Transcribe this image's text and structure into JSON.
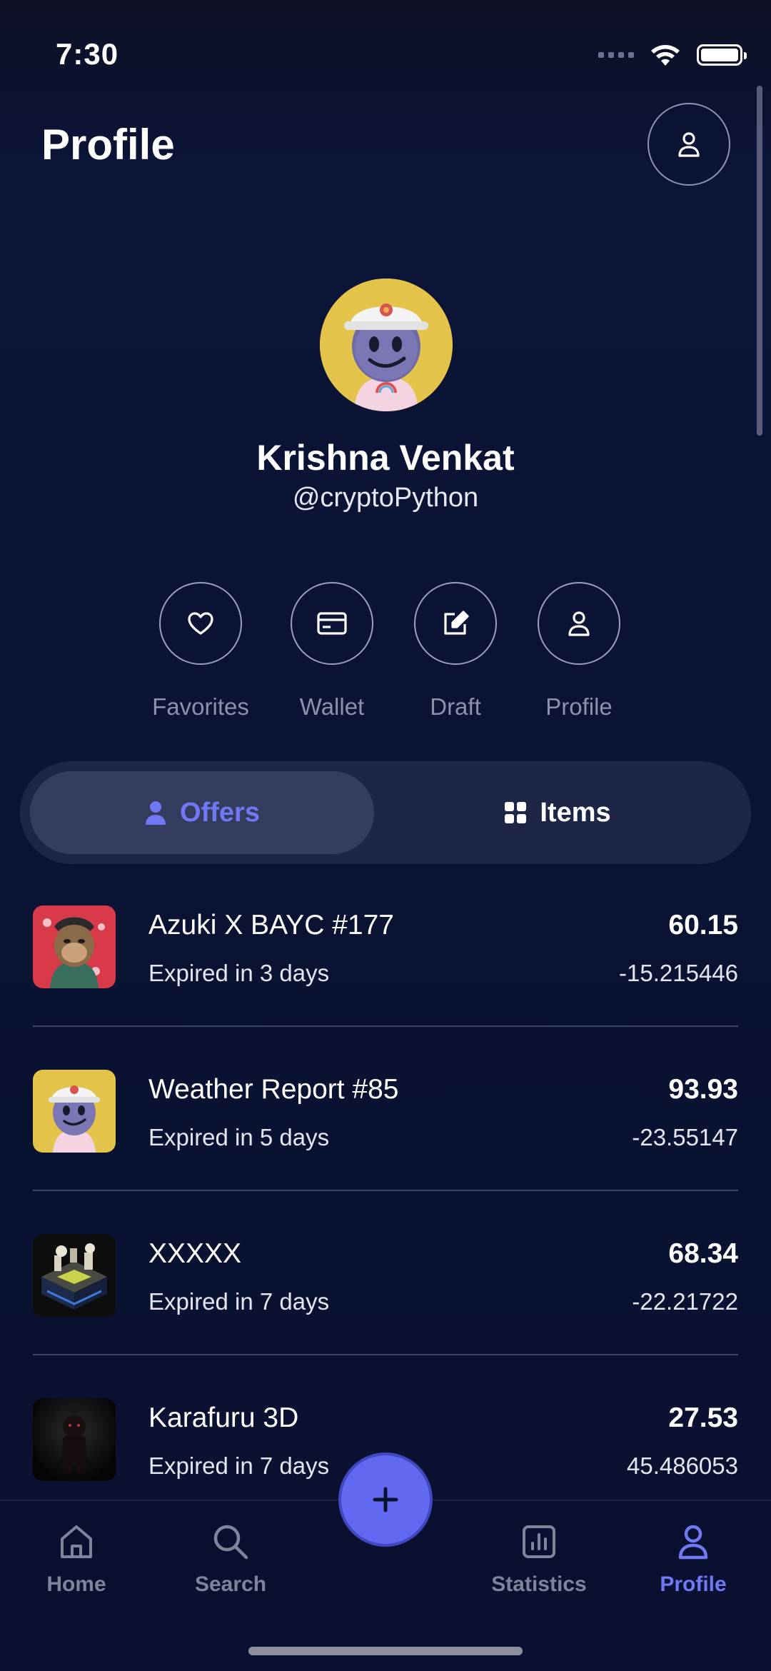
{
  "status_bar": {
    "time": "7:30"
  },
  "header": {
    "title": "Profile"
  },
  "user": {
    "name": "Krishna Venkat",
    "handle": "@cryptoPython"
  },
  "actions": [
    {
      "label": "Favorites",
      "icon": "heart-icon"
    },
    {
      "label": "Wallet",
      "icon": "wallet-icon"
    },
    {
      "label": "Draft",
      "icon": "edit-icon"
    },
    {
      "label": "Profile",
      "icon": "user-icon"
    }
  ],
  "segments": {
    "offers_label": "Offers",
    "items_label": "Items",
    "selected": "Offers"
  },
  "offers": [
    {
      "name": "Azuki X BAYC #177",
      "subtitle": "Expired in 3 days",
      "price": "60.15",
      "change": "-15.215446",
      "thumb": "ape-art"
    },
    {
      "name": "Weather Report #85",
      "subtitle": "Expired in 5 days",
      "price": "93.93",
      "change": "-23.55147",
      "thumb": "helmet-character"
    },
    {
      "name": "XXXXX",
      "subtitle": "Expired in 7 days",
      "price": "68.34",
      "change": "-22.21722",
      "thumb": "isometric-city"
    },
    {
      "name": "Karafuru 3D",
      "subtitle": "Expired in 7 days",
      "price": "27.53",
      "change": "45.486053",
      "thumb": "dark-figure"
    }
  ],
  "tabbar": {
    "home_label": "Home",
    "search_label": "Search",
    "statistics_label": "Statistics",
    "profile_label": "Profile",
    "active": "Profile"
  },
  "colors": {
    "accent": "#6269f0",
    "background": "#0b1232",
    "segment": "#1e2648",
    "muted": "#7f849d"
  }
}
